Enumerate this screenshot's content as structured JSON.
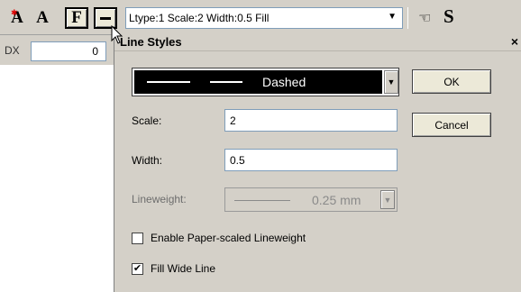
{
  "toolbar": {
    "text_style_letter": "A",
    "text_style_star": "✱",
    "text_letter": "A",
    "fill_letter": "F",
    "linetype_combo_value": "Ltype:1 Scale:2 Width:0.5 Fill",
    "linetype_combo_arrow": "▼",
    "hand_icon_glyph": "☜",
    "s_letter": "S"
  },
  "dx": {
    "label": "DX",
    "value": "0"
  },
  "dialog": {
    "title": "Line Styles",
    "close": "×",
    "line_style": {
      "selected": "Dashed",
      "arrow": "▼"
    },
    "buttons": {
      "ok": "OK",
      "cancel": "Cancel"
    },
    "scale": {
      "label": "Scale:",
      "value": "2"
    },
    "width": {
      "label": "Width:",
      "value": "0.5"
    },
    "lineweight": {
      "label": "Lineweight:",
      "value": "0.25 mm",
      "arrow": "▼",
      "enabled": false
    },
    "checkboxes": {
      "paper_scaled": {
        "label": "Enable Paper-scaled Lineweight",
        "checked": false,
        "mark": ""
      },
      "fill_wide": {
        "label": "Fill Wide Line",
        "checked": true,
        "mark": "✔"
      }
    }
  },
  "colors": {
    "chrome": "#d4d0c8",
    "field_border": "#7f9db9",
    "accent_red": "#e00000",
    "disabled_text": "#8a8a8a"
  }
}
